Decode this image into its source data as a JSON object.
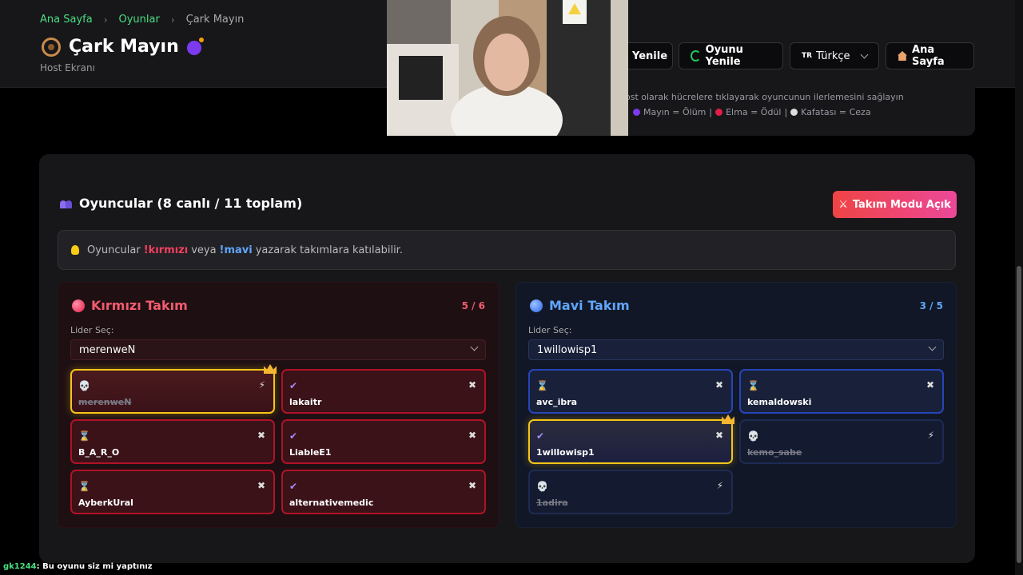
{
  "breadcrumb": {
    "home": "Ana Sayfa",
    "games": "Oyunlar",
    "current": "Çark Mayın",
    "sep": "›"
  },
  "header": {
    "title": "Çark Mayın",
    "subtitle": "Host Ekranı"
  },
  "toolbar": {
    "refresh_partial": "Yenile",
    "refresh_game": "Oyunu Yenile",
    "lang_flag": "TR",
    "lang_value": "Türkçe",
    "home": "Ana Sayfa"
  },
  "host_info": {
    "line1": "ost olarak hücrelere tıklayarak oyuncunun ilerlemesini sağlayın",
    "mine": "Mayın = Ölüm",
    "apple": "Elma = Ödül",
    "skull": "Kafatası = Ceza",
    "sep": "|"
  },
  "players": {
    "heading": "Oyuncular (8 canlı / 11 toplam)",
    "team_mode_button": "Takım Modu Açık",
    "info_prefix": "Oyuncular",
    "info_red": "!kırmızı",
    "info_mid": "veya",
    "info_blue": "!mavi",
    "info_suffix": "yazarak takımlara katılabilir."
  },
  "red_team": {
    "title": "Kırmızı Takım",
    "count": "5 / 6",
    "leader_label": "Lider Seç:",
    "leader_value": "merenweN",
    "members": [
      {
        "name": "merenweN",
        "status": "💀",
        "action": "⚡",
        "dead": true,
        "leader": true
      },
      {
        "name": "lakaitr",
        "status": "✔",
        "action": "✖",
        "dead": false,
        "leader": false
      },
      {
        "name": "B_A_R_O",
        "status": "⌛",
        "action": "✖",
        "dead": false,
        "leader": false
      },
      {
        "name": "LiableE1",
        "status": "✔",
        "action": "✖",
        "dead": false,
        "leader": false
      },
      {
        "name": "AyberkUral",
        "status": "⌛",
        "action": "✖",
        "dead": false,
        "leader": false
      },
      {
        "name": "alternativemedic",
        "status": "✔",
        "action": "✖",
        "dead": false,
        "leader": false
      }
    ]
  },
  "blue_team": {
    "title": "Mavi Takım",
    "count": "3 / 5",
    "leader_label": "Lider Seç:",
    "leader_value": "1willowisp1",
    "members": [
      {
        "name": "avc_ibra",
        "status": "⌛",
        "action": "✖",
        "dead": false,
        "leader": false
      },
      {
        "name": "kemaldowski",
        "status": "⌛",
        "action": "✖",
        "dead": false,
        "leader": false
      },
      {
        "name": "1willowisp1",
        "status": "✔",
        "action": "✖",
        "dead": false,
        "leader": true
      },
      {
        "name": "kemo_sabe",
        "status": "💀",
        "action": "⚡",
        "dead": true,
        "leader": false
      },
      {
        "name": "1adira",
        "status": "💀",
        "action": "⚡",
        "dead": true,
        "leader": false
      }
    ]
  },
  "chat": {
    "user": "gk1244",
    "message": ": Bu oyunu siz mi yaptınız"
  },
  "colors": {
    "accent_green": "#4ade80",
    "red": "#f25c6e",
    "blue": "#60a5fa",
    "leader_gold": "#f5c518"
  }
}
